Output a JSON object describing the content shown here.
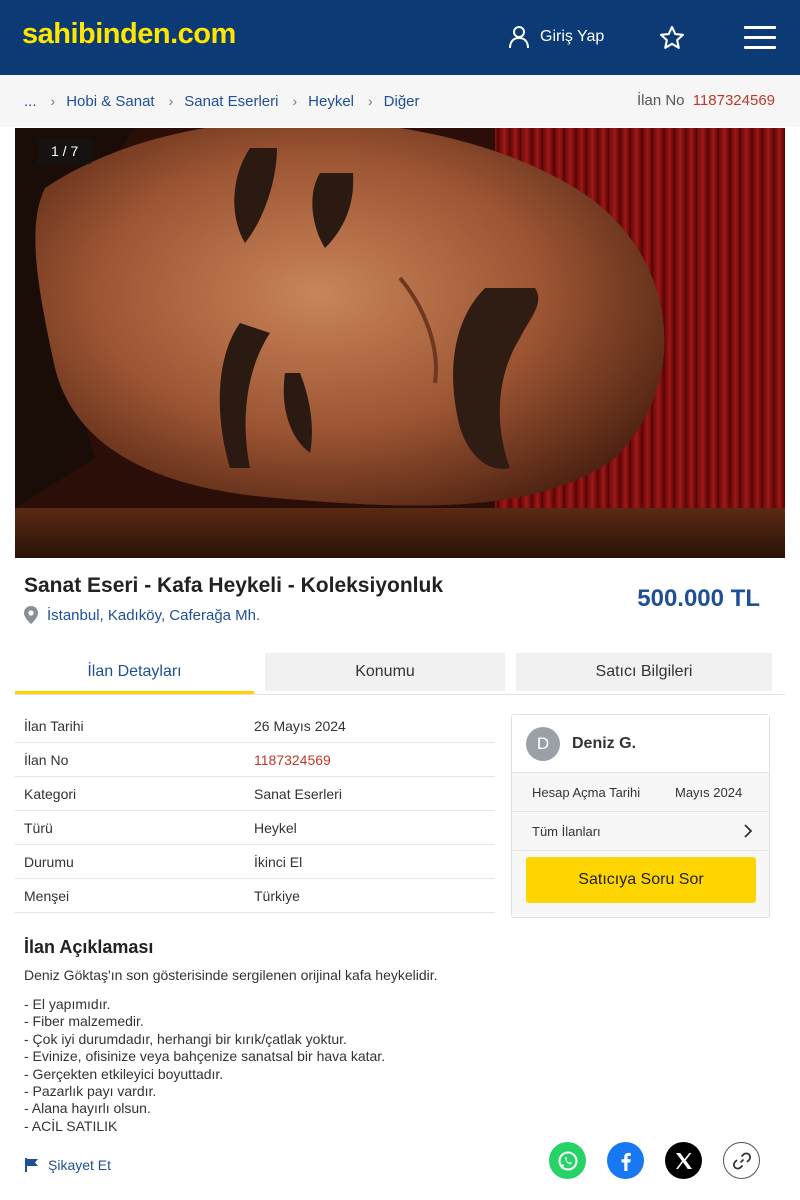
{
  "header": {
    "logo": "sahibinden.com",
    "login_label": "Giriş Yap",
    "icons": [
      "user-icon",
      "star-icon",
      "hamburger-menu-icon"
    ],
    "bg_color": "#0b3a74",
    "logo_color": "#ffe600"
  },
  "breadcrumb": {
    "items": [
      "...",
      "Hobi & Sanat",
      "Sanat Eserleri",
      "Heykel",
      "Diğer"
    ],
    "ilan_no_label": "İlan No",
    "ilan_no_value": "1187324569"
  },
  "gallery": {
    "counter": "1 / 7"
  },
  "listing": {
    "title": "Sanat Eseri - Kafa Heykeli - Koleksiyonluk",
    "location": "İstanbul, Kadıköy, Caferağa Mh.",
    "price": "500.000 TL"
  },
  "tabs": [
    {
      "label": "İlan Detayları",
      "active": true
    },
    {
      "label": "Konumu",
      "active": false
    },
    {
      "label": "Satıcı Bilgileri",
      "active": false
    }
  ],
  "details": [
    {
      "label": "İlan Tarihi",
      "value": "26 Mayıs 2024"
    },
    {
      "label": "İlan No",
      "value": "1187324569"
    },
    {
      "label": "Kategori",
      "value": "Sanat Eserleri"
    },
    {
      "label": "Türü",
      "value": "Heykel"
    },
    {
      "label": "Durumu",
      "value": "İkinci El"
    },
    {
      "label": "Menşei",
      "value": "Türkiye"
    }
  ],
  "seller": {
    "avatar_letter": "D",
    "name": "Deniz G.",
    "account_date_label": "Hesap Açma Tarihi",
    "account_date_value": "Mayıs 2024",
    "all_listings_label": "Tüm İlanları",
    "ask_button": "Satıcıya Soru Sor"
  },
  "description": {
    "title": "İlan Açıklaması",
    "main": "Deniz Göktaş'ın son gösterisinde sergilenen orijinal kafa heykelidir.",
    "items": [
      "- El yapımıdır.",
      "- Fiber malzemedir.",
      "- Çok iyi durumdadır, herhangi bir kırık/çatlak yoktur.",
      "- Evinize, ofisinize veya bahçenize sanatsal bir hava katar.",
      "- Gerçekten etkileyici boyuttadır.",
      "- Pazarlık payı vardır.",
      "- Alana hayırlı olsun.",
      "- ACİL SATILIK"
    ]
  },
  "footer": {
    "report_label": "Şikayet Et",
    "share_icons": [
      "whatsapp-icon",
      "facebook-icon",
      "x-icon",
      "link-icon"
    ]
  },
  "colors": {
    "accent_blue": "#1f4f97",
    "accent_yellow": "#ffd500",
    "ilan_no_red": "#c0392b"
  }
}
